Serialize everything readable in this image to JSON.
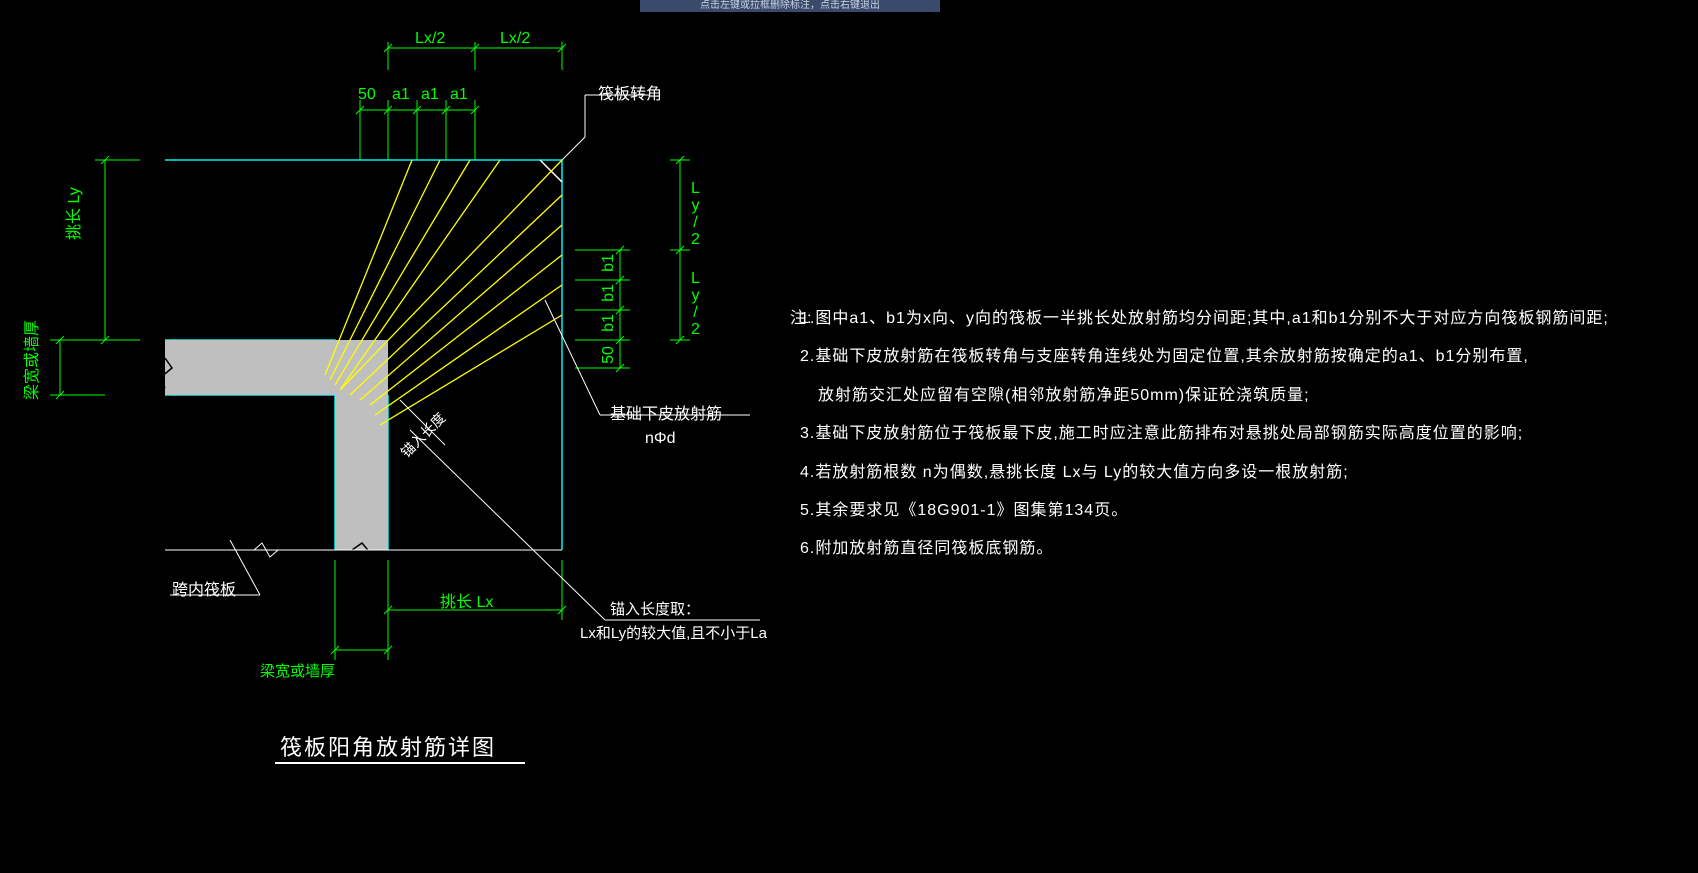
{
  "status_bar": "点击左键或拉框删除标注，点击右键退出",
  "dims": {
    "lx2_left": "Lx/2",
    "lx2_right": "Lx/2",
    "top50": "50",
    "a1_1": "a1",
    "a1_2": "a1",
    "a1_3": "a1",
    "ly2_top": "Ly/2",
    "ly2_bot": "Ly/2",
    "b1_1": "b1",
    "b1_2": "b1",
    "b1_3": "b1",
    "right50": "50",
    "left_ly": "挑长 Ly",
    "left_thick": "梁宽或墙厚",
    "bot_lx": "挑长 Lx",
    "bot_thick": "梁宽或墙厚"
  },
  "labels": {
    "corner": "筏板转角",
    "anchor_len": "锚入长度",
    "foundation_rebar": "基础下皮放射筋",
    "nphi": "nΦd",
    "inner_raft": "跨内筏板",
    "anchor_desc1": "锚入长度取：",
    "anchor_desc2": "Lx和Ly的较大值,且不小于La"
  },
  "title": "筏板阳角放射筋详图",
  "notes_header": "注:",
  "notes": [
    "1.图中a1、b1为x向、y向的筏板一半挑长处放射筋均分间距;其中,a1和b1分别不大于对应方向筏板钢筋间距;",
    "2.基础下皮放射筋在筏板转角与支座转角连线处为固定位置,其余放射筋按确定的a1、b1分别布置,",
    "  放射筋交汇处应留有空隙(相邻放射筋净距50mm)保证砼浇筑质量;",
    "3.基础下皮放射筋位于筏板最下皮,施工时应注意此筋排布对悬挑处局部钢筋实际高度位置的影响;",
    "4.若放射筋根数 n为偶数,悬挑长度 Lx与 Ly的较大值方向多设一根放射筋;",
    "5.其余要求见《18G901-1》图集第134页。",
    "6.附加放射筋直径同筏板底钢筋。"
  ]
}
